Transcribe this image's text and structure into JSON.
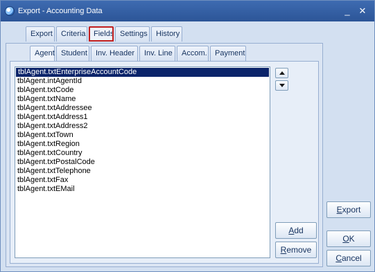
{
  "window": {
    "title": "Export - Accounting Data",
    "minimize_glyph": "_",
    "close_glyph": "✕"
  },
  "main_tabs": [
    {
      "label": "Export"
    },
    {
      "label": "Criteria"
    },
    {
      "label": "Fields"
    },
    {
      "label": "Settings"
    },
    {
      "label": "History"
    }
  ],
  "sub_tabs": [
    {
      "label": "Agent"
    },
    {
      "label": "Student"
    },
    {
      "label": "Inv. Header"
    },
    {
      "label": "Inv. Line"
    },
    {
      "label": "Accom."
    },
    {
      "label": "Payment"
    }
  ],
  "fields_list": [
    "tblAgent.txtEnterpriseAccountCode",
    "tblAgent.intAgentId",
    "tblAgent.txtCode",
    "tblAgent.txtName",
    "tblAgent.txtAddressee",
    "tblAgent.txtAddress1",
    "tblAgent.txtAddress2",
    "tblAgent.txtTown",
    "tblAgent.txtRegion",
    "tblAgent.txtCountry",
    "tblAgent.txtPostalCode",
    "tblAgent.txtTelephone",
    "tblAgent.txtFax",
    "tblAgent.txtEMail"
  ],
  "buttons": {
    "add": {
      "mnemonic": "A",
      "rest": "dd"
    },
    "remove": {
      "mnemonic": "R",
      "rest": "emove"
    },
    "export": {
      "mnemonic": "E",
      "rest": "xport"
    },
    "ok": {
      "mnemonic": "O",
      "rest": "K"
    },
    "cancel": {
      "mnemonic": "C",
      "rest": "ancel"
    }
  },
  "colors": {
    "selection": "#0b246a",
    "highlight_outline": "#c21f1f",
    "titlebar": "#2c5597"
  }
}
